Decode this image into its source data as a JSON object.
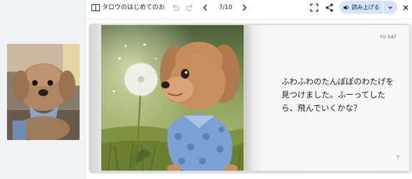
{
  "toolbar": {
    "title": "タロウのはじめてのお...",
    "page_indicator": "7/10",
    "read_aloud_label": "読み上げる"
  },
  "book": {
    "author": "YU SAT",
    "story_text": "ふわふわのたんぽぽのわたげを見つけました。ふーってしたら、飛んでいくかな？",
    "page_number": "7"
  },
  "colors": {
    "read_aloud_bg": "#d7e3fb",
    "toolbar_bg": "#ffffff",
    "side_bg": "#f1f2f4"
  },
  "icons": [
    "book-icon",
    "undo-icon",
    "redo-icon",
    "prev-icon",
    "next-icon",
    "fullscreen-icon",
    "share-icon",
    "speaker-icon",
    "chevron-down-icon",
    "close-icon"
  ]
}
